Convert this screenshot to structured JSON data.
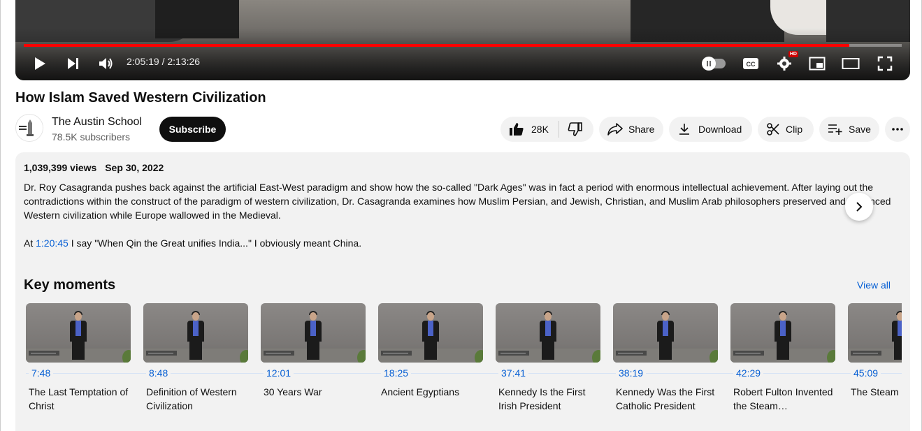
{
  "player": {
    "time_display": "2:05:19 / 2:13:26",
    "progress_fraction": 0.94,
    "quality_badge": "HD"
  },
  "video": {
    "title": "How Islam Saved Western Civilization"
  },
  "channel": {
    "name": "The Austin School",
    "subscribers": "78.5K subscribers",
    "subscribe_label": "Subscribe"
  },
  "actions": {
    "likes": "28K",
    "share": "Share",
    "download": "Download",
    "clip": "Clip",
    "save": "Save"
  },
  "description": {
    "views": "1,039,399 views",
    "date": "Sep 30, 2022",
    "paragraph": "Dr. Roy Casagranda pushes back against the artificial East-West paradigm and show how the so-called \"Dark Ages\" was in fact a period with enormous intellectual achievement. After laying out the contradictions within the construct of the paradigm of western civilization, Dr. Casagranda examines how Muslim Persian, and Jewish, Christian, and Muslim Arab philosophers preserved and advanced Western civilization while Europe wallowed in the Medieval.",
    "at_prefix": "At",
    "at_link": "1:20:45",
    "at_rest": "I say \"When Qin the Great unifies India...\" I obviously meant China."
  },
  "key_moments": {
    "title": "Key moments",
    "view_all": "View all",
    "items": [
      {
        "time": "7:48",
        "label": "The Last Temptation of Christ"
      },
      {
        "time": "8:48",
        "label": "Definition of Western Civilization"
      },
      {
        "time": "12:01",
        "label": "30 Years War"
      },
      {
        "time": "18:25",
        "label": "Ancient Egyptians"
      },
      {
        "time": "37:41",
        "label": "Kennedy Is the First Irish President"
      },
      {
        "time": "38:19",
        "label": "Kennedy Was the First Catholic President"
      },
      {
        "time": "42:29",
        "label": "Robert Fulton Invented the Steam…"
      },
      {
        "time": "45:09",
        "label": "The Steam Engine"
      }
    ]
  },
  "colors": {
    "accent_red": "#ff0000",
    "link_blue": "#065fd4",
    "panel_gray": "#f2f2f2"
  },
  "icons": [
    "play-icon",
    "next-icon",
    "volume-icon",
    "autoplay-toggle",
    "cc-icon",
    "settings-icon",
    "miniplayer-icon",
    "theater-icon",
    "fullscreen-icon",
    "thumbs-up-icon",
    "thumbs-down-icon",
    "share-icon",
    "download-icon",
    "scissors-icon",
    "playlist-add-icon",
    "more-horiz-icon",
    "chevron-right-icon"
  ]
}
